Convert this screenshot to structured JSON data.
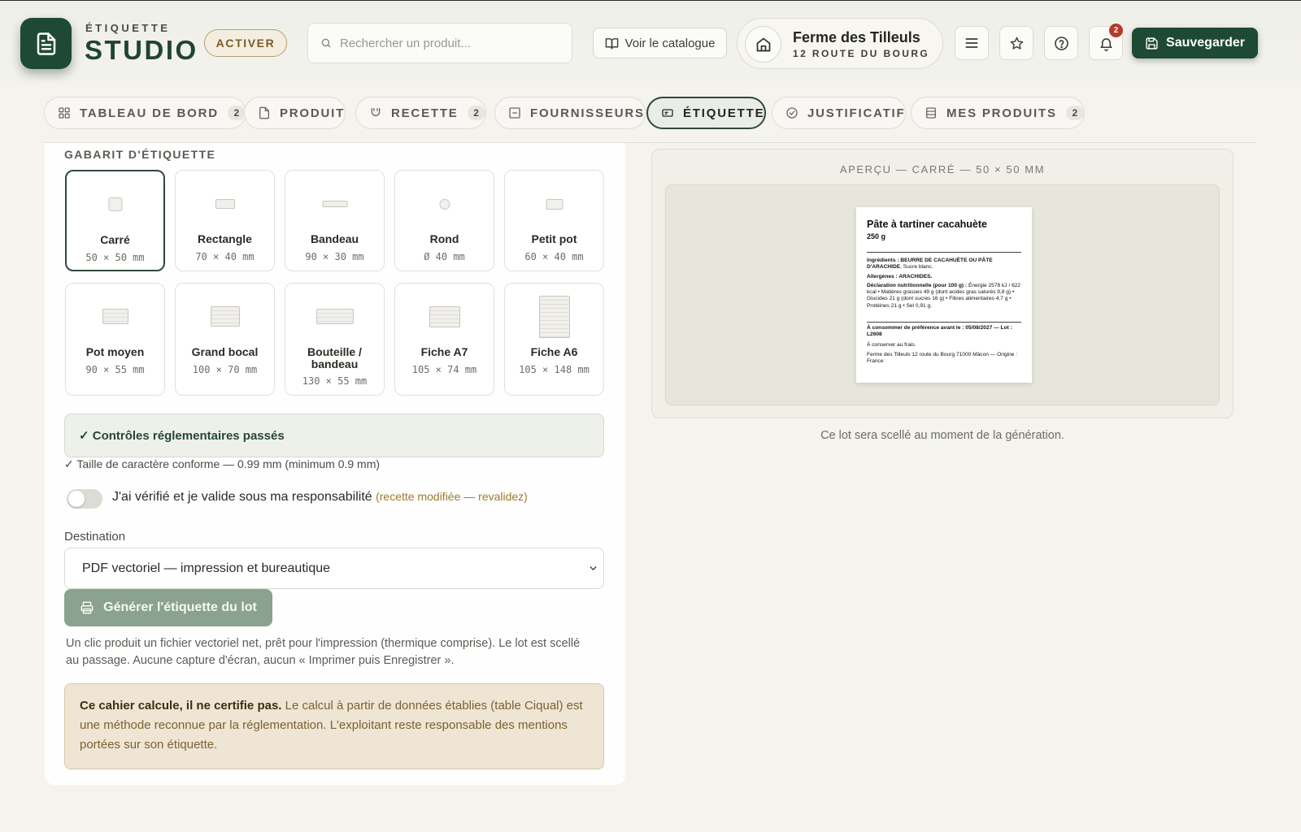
{
  "app": {
    "brand_top": "ÉTIQUETTE",
    "brand_main": "STUDIO",
    "activate_label": "ACTIVER"
  },
  "search": {
    "placeholder": "Rechercher un produit..."
  },
  "header": {
    "catalog_label": "Voir le catalogue",
    "farm_name": "Ferme des Tilleuls",
    "farm_address": "12 ROUTE DU BOURG",
    "notifications_count": "2",
    "save_label": "Sauvegarder"
  },
  "tabs": [
    {
      "label": "TABLEAU DE BORD",
      "count": "2"
    },
    {
      "label": "PRODUIT"
    },
    {
      "label": "RECETTE",
      "count": "2"
    },
    {
      "label": "FOURNISSEURS"
    },
    {
      "label": "ÉTIQUETTE",
      "active": true
    },
    {
      "label": "JUSTIFICATIF"
    },
    {
      "label": "MES PRODUITS",
      "count": "2"
    }
  ],
  "templates": {
    "title": "GABARIT D'ÉTIQUETTE",
    "items": [
      {
        "name": "Carré",
        "dims": "50 × 50 mm",
        "selected": true
      },
      {
        "name": "Rectangle",
        "dims": "70 × 40 mm"
      },
      {
        "name": "Bandeau",
        "dims": "90 × 30 mm"
      },
      {
        "name": "Rond",
        "dims": "Ø 40 mm"
      },
      {
        "name": "Petit pot",
        "dims": "60 × 40 mm"
      },
      {
        "name": "Pot moyen",
        "dims": "90 × 55 mm"
      },
      {
        "name": "Grand bocal",
        "dims": "100 × 70 mm"
      },
      {
        "name": "Bouteille / bandeau",
        "dims": "130 × 55 mm"
      },
      {
        "name": "Fiche A7",
        "dims": "105 × 74 mm"
      },
      {
        "name": "Fiche A6",
        "dims": "105 × 148 mm"
      }
    ]
  },
  "controls": {
    "passed": "✓ Contrôles réglementaires passés",
    "font_check": "✓ Taille de caractère conforme — 0.99 mm (minimum 0.9 mm)"
  },
  "validation": {
    "label": "J'ai vérifié et je valide sous ma responsabilité",
    "warning": "(recette modifiée — revalidez)",
    "checked": false
  },
  "destination": {
    "label": "Destination",
    "selected": "PDF vectoriel — impression et bureautique"
  },
  "generate": {
    "button_label": "Générer l'étiquette du lot",
    "help": "Un clic produit un fichier vectoriel net, prêt pour l'impression (thermique comprise). Le lot est scellé au passage. Aucune capture d'écran, aucun « Imprimer puis Enregistrer »."
  },
  "disclaimer": {
    "bold": "Ce cahier calcule, il ne certifie pas.",
    "text": "Le calcul à partir de données établies (table Ciqual) est une méthode reconnue par la réglementation. L'exploitant reste responsable des mentions portées sur son étiquette."
  },
  "preview": {
    "title": "APERÇU — CARRÉ — 50 × 50 MM",
    "note": "Ce lot sera scellé au moment de la génération.",
    "label": {
      "product": "Pâte à tartiner cacahuète",
      "weight": "250 g",
      "ingredients_label": "Ingrédients :",
      "ingredients_bold": "BEURRE DE CACAHUÈTE OU PÂTE D'ARACHIDE",
      "ingredients_rest": ", Sucre blanc.",
      "allergens": "Allergènes : ARACHIDES.",
      "nutrition_label": "Déclaration nutritionnelle (pour 100 g) :",
      "nutrition_values": "Énergie 2578 kJ / 622 kcal • Matières grasses 49 g (dont acides gras saturés 9,8 g) • Glucides 21 g (dont sucres 16 g) • Fibres alimentaires 4,7 g • Protéines 21 g • Sel 0,91 g.",
      "best_before": "À consommer de préférence avant le : 05/08/2027 — Lot : L2608",
      "storage": "À conserver au frais.",
      "producer": "Ferme des Tilleuls 12 route du Bourg 71000 Mâcon — Origine : France"
    }
  },
  "colors": {
    "brand": "#1e4a33",
    "accent_gold": "#b59f72",
    "success_bg": "#eef0ea",
    "warning_bg": "#efe5d4",
    "badge_red": "#b53b2c"
  }
}
